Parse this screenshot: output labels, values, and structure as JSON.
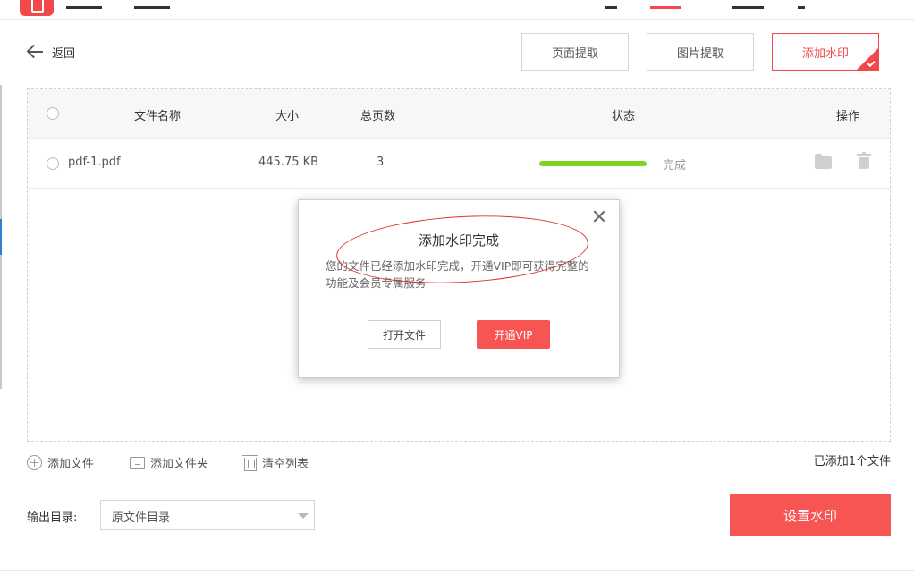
{
  "header": {
    "back_label": "返回",
    "modes": [
      {
        "label": "页面提取"
      },
      {
        "label": "图片提取"
      },
      {
        "label": "添加水印"
      }
    ],
    "accent_color": "#f2484b"
  },
  "table": {
    "columns": {
      "name": "文件名称",
      "size": "大小",
      "pages": "总页数",
      "status": "状态",
      "actions": "操作"
    },
    "rows": [
      {
        "name": "pdf-1.pdf",
        "size": "445.75 KB",
        "pages": "3",
        "status": "完成",
        "progress": 1.0,
        "icons": [
          "folder-icon",
          "trash-icon"
        ]
      }
    ]
  },
  "dialog": {
    "title": "添加水印完成",
    "message": "您的文件已经添加水印完成，开通VIP即可获得完整的功能及会员专属服务",
    "open_button": "打开文件",
    "vip_button": "开通VIP",
    "close_icon": "close-icon"
  },
  "toolbar": {
    "add_file": "添加文件",
    "add_folder": "添加文件夹",
    "clear_list": "清空列表",
    "file_count": "已添加1个文件"
  },
  "output": {
    "label": "输出目录:",
    "selected": "原文件目录"
  },
  "main_action": {
    "label": "设置水印",
    "color": "#f75454"
  }
}
